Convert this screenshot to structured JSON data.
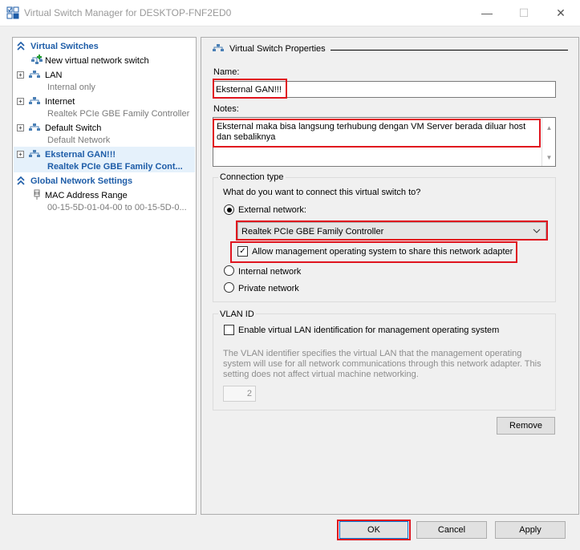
{
  "window": {
    "title": "Virtual Switch Manager for DESKTOP-FNF2ED0",
    "minimize_glyph": "—",
    "maximize_glyph": "☐",
    "close_glyph": "✕"
  },
  "sidebar": {
    "virtual_switches_header": "Virtual Switches",
    "new_switch": "New virtual network switch",
    "switches": [
      {
        "name": "LAN",
        "sub": "Internal only",
        "expander": "+"
      },
      {
        "name": "Internet",
        "sub": "Realtek PCIe GBE Family Controller",
        "expander": "+"
      },
      {
        "name": "Default Switch",
        "sub": "Default Network",
        "expander": "+"
      },
      {
        "name": "Eksternal GAN!!!",
        "sub": "Realtek PCIe GBE Family Cont...",
        "expander": "+",
        "selected": true
      }
    ],
    "global_header": "Global Network Settings",
    "mac": {
      "name": "MAC Address Range",
      "sub": "00-15-5D-01-04-00 to 00-15-5D-0..."
    }
  },
  "properties": {
    "header": "Virtual Switch Properties",
    "name_label": "Name:",
    "name_value": "Eksternal GAN!!!",
    "notes_label": "Notes:",
    "notes_value": "Eksternal maka bisa langsung terhubung dengan VM Server berada diluar host dan sebaliknya",
    "connection": {
      "legend": "Connection type",
      "question": "What do you want to connect this virtual switch to?",
      "external_label": "External network:",
      "external_selected": true,
      "adapter_value": "Realtek PCIe GBE Family Controller",
      "allow_mgmt_label": "Allow management operating system to share this network adapter",
      "allow_mgmt_checked": "✓",
      "internal_label": "Internal network",
      "private_label": "Private network"
    },
    "vlan": {
      "legend": "VLAN ID",
      "enable_label": "Enable virtual LAN identification for management operating system",
      "description": "The VLAN identifier specifies the virtual LAN that the management operating system will use for all network communications through this network adapter. This setting does not affect virtual machine networking.",
      "id_value": "2"
    },
    "remove_label": "Remove"
  },
  "footer": {
    "ok_label": "OK",
    "cancel_label": "Cancel",
    "apply_label": "Apply"
  },
  "colors": {
    "highlight_box": "#e0141e",
    "section_header": "#1e5da8",
    "selection_bg": "#e5f1fb"
  }
}
